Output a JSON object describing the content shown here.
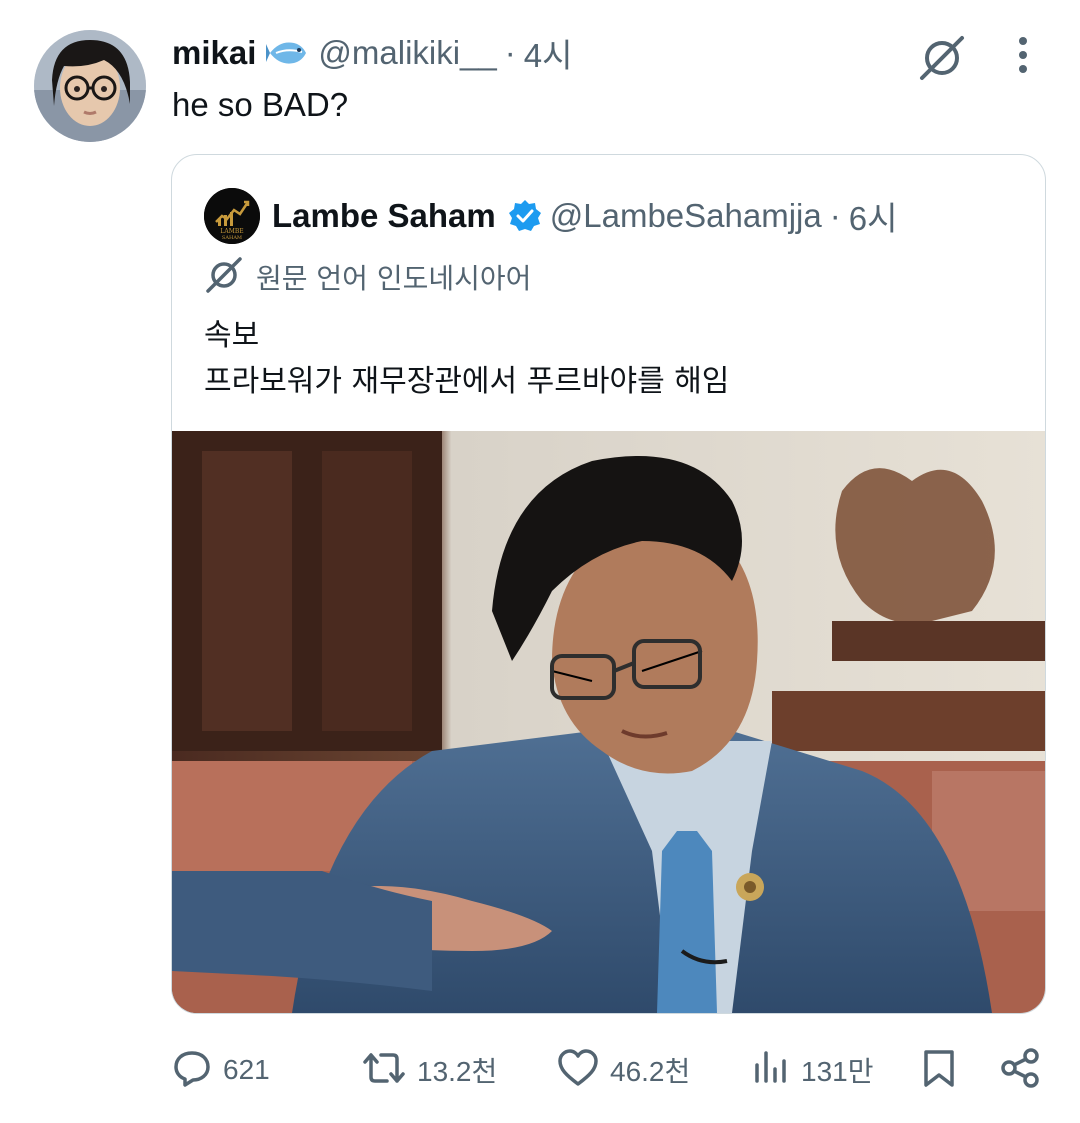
{
  "post": {
    "author_name": "mikai",
    "author_handle": "@malikiki__",
    "separator": "·",
    "time": "4시",
    "text": "he so BAD?"
  },
  "quote": {
    "author_name": "Lambe Saham",
    "author_handle": "@LambeSahamjja",
    "separator": "·",
    "time": "6시",
    "translated_from": "원문 언어 인도네시아어",
    "text_lines": [
      "속보",
      "프라보워가 재무장관에서 푸르바야를 해임"
    ],
    "avatar_logo_text": "LAMBE SAHAM",
    "verified_color": "#1d9bf0"
  },
  "actions": {
    "reply_count": "621",
    "repost_count": "13.2천",
    "like_count": "46.2천",
    "views_count": "131만"
  },
  "icons": {
    "author_emoji": "fish-icon",
    "translate": "translate-icon",
    "more": "more-dots-icon",
    "reply": "reply-icon",
    "repost": "repost-icon",
    "like": "heart-icon",
    "views": "views-icon",
    "bookmark": "bookmark-icon",
    "share": "share-icon"
  },
  "colors": {
    "text_primary": "#0f1419",
    "text_secondary": "#536471",
    "border": "#cfd9de"
  }
}
